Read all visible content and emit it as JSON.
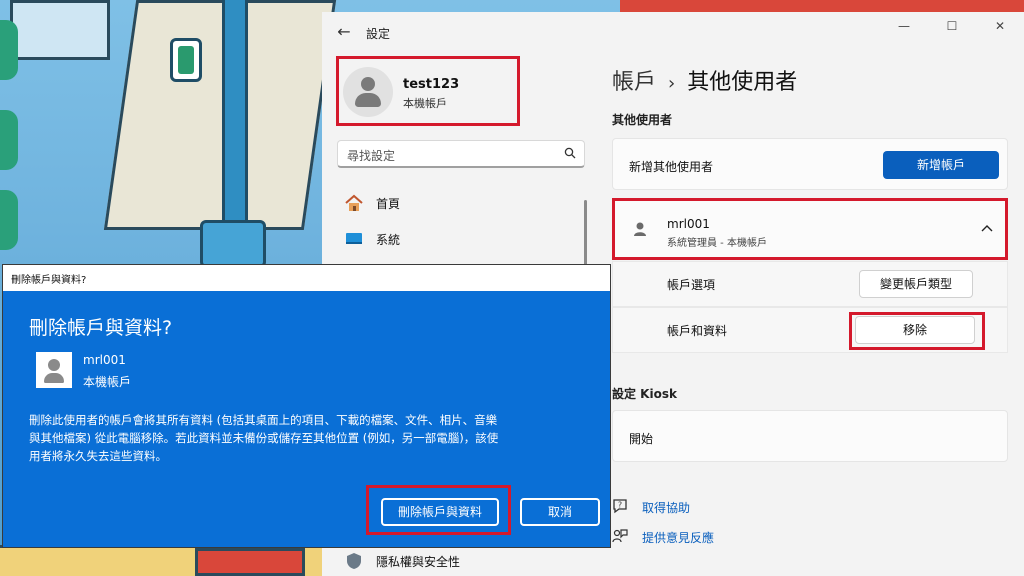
{
  "settings": {
    "app_title": "設定",
    "window_controls": {
      "minimize": "—",
      "maximize": "☐",
      "close": "✕"
    },
    "profile": {
      "name": "test123",
      "type": "本機帳戶"
    },
    "search": {
      "placeholder": "尋找設定"
    },
    "nav": [
      {
        "label": "首頁",
        "icon": "home-icon"
      },
      {
        "label": "系統",
        "icon": "system-icon"
      },
      {
        "label": "隱私權與安全性",
        "icon": "shield-icon"
      }
    ],
    "breadcrumb": {
      "parent": "帳戶",
      "separator": "›",
      "current": "其他使用者"
    },
    "other_users": {
      "section_title": "其他使用者",
      "add_label": "新增其他使用者",
      "add_button": "新增帳戶",
      "user": {
        "name": "mrl001",
        "subtitle": "系統管理員 - 本機帳戶"
      },
      "account_options_label": "帳戶選項",
      "change_type_button": "變更帳戶類型",
      "account_data_label": "帳戶和資料",
      "remove_button": "移除"
    },
    "kiosk": {
      "section_title": "設定 Kiosk",
      "start_label": "開始"
    },
    "help": [
      {
        "label": "取得協助",
        "icon": "help-icon"
      },
      {
        "label": "提供意見反應",
        "icon": "feedback-icon"
      }
    ]
  },
  "dialog": {
    "window_title": "刪除帳戶與資料?",
    "title": "刪除帳戶與資料?",
    "user": {
      "name": "mrl001",
      "type": "本機帳戶"
    },
    "body_lines": [
      "刪除此使用者的帳戶會將其所有資料 (包括其桌面上的項目、下載的檔案、文件、相片、音樂",
      "與其他檔案) 從此電腦移除。若此資料並未備份或儲存至其他位置 (例如，另一部電腦)，該使",
      "用者將永久失去這些資料。"
    ],
    "confirm_button": "刪除帳戶與資料",
    "cancel_button": "取消"
  },
  "colors": {
    "accent": "#0a5fbd",
    "dialog_bg": "#0a6fd6",
    "highlight": "#d4192c"
  }
}
